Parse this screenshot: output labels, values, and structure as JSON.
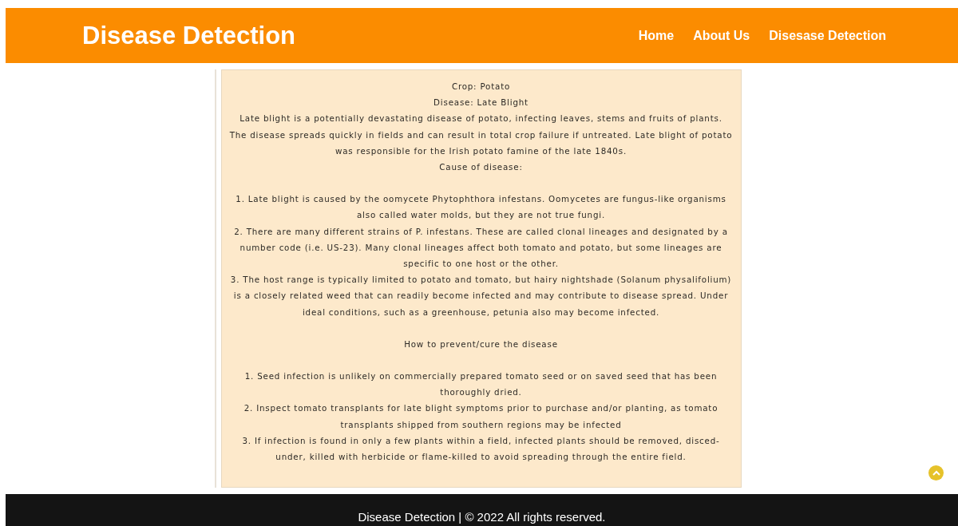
{
  "header": {
    "title": "Disease Detection",
    "nav": [
      {
        "label": "Home"
      },
      {
        "label": "About Us"
      },
      {
        "label": "Disesase Detection"
      }
    ]
  },
  "card": {
    "crop": "Crop: Potato",
    "disease": "Disease: Late Blight",
    "description": "Late blight is a potentially devastating disease of potato, infecting leaves, stems and fruits of plants. The disease spreads quickly in fields and can result in total crop failure if untreated. Late blight of potato was responsible for the Irish potato famine of the late 1840s.",
    "sections": [
      {
        "heading": "Cause of disease:",
        "items": [
          "1. Late blight is caused by the oomycete Phytophthora infestans. Oomycetes are fungus-like organisms also called water molds, but they are not true fungi.",
          "2. There are many different strains of P. infestans. These are called clonal lineages and designated by a number code (i.e. US-23). Many clonal lineages affect both tomato and potato, but some lineages are specific to one host or the other.",
          "3. The host range is typically limited to potato and tomato, but hairy nightshade (Solanum physalifolium) is a closely related weed that can readily become infected and may contribute to disease spread. Under ideal conditions, such as a greenhouse, petunia also may become infected."
        ]
      },
      {
        "heading": "How to prevent/cure the disease",
        "items": [
          "1. Seed infection is unlikely on commercially prepared tomato seed or on saved seed that has been thoroughly dried.",
          "2. Inspect tomato transplants for late blight symptoms prior to purchase and/or planting, as tomato transplants shipped from southern regions may be infected",
          "3. If infection is found in only a few plants within a field, infected plants should be removed, disced-under, killed with herbicide or flame-killed to avoid spreading through the entire field."
        ]
      }
    ]
  },
  "footer": {
    "text": "Disease Detection | © 2022 All rights reserved."
  }
}
